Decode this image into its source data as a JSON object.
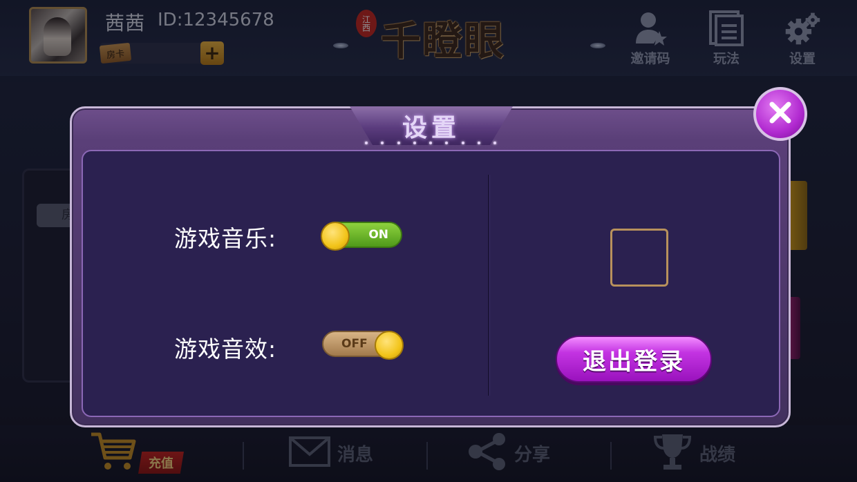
{
  "user": {
    "name": "茜茜",
    "id_label": "ID:12345678",
    "room_card_label": "房卡",
    "room_card_count": "",
    "add_label": "+"
  },
  "logo": {
    "seal_text": "江西",
    "title": "千瞪眼"
  },
  "top_menu": [
    {
      "label": "邀请码",
      "icon": "person-star-icon"
    },
    {
      "label": "玩法",
      "icon": "rules-icon"
    },
    {
      "label": "设置",
      "icon": "gear-icon"
    }
  ],
  "side_left": {
    "chip_label": "房"
  },
  "bottom_nav": {
    "recharge_label": "充值",
    "messages_label": "消息",
    "share_label": "分享",
    "record_label": "战绩"
  },
  "settings_dialog": {
    "title": "设置",
    "music_label": "游戏音乐:",
    "music_state": "ON",
    "sfx_label": "游戏音效:",
    "sfx_state": "OFF",
    "logout_label": "退出登录"
  },
  "colors": {
    "accent_purple": "#b12ad0",
    "toggle_on": "#6ab82a",
    "toggle_off": "#c29e70",
    "knob_yellow": "#f2c41a"
  }
}
